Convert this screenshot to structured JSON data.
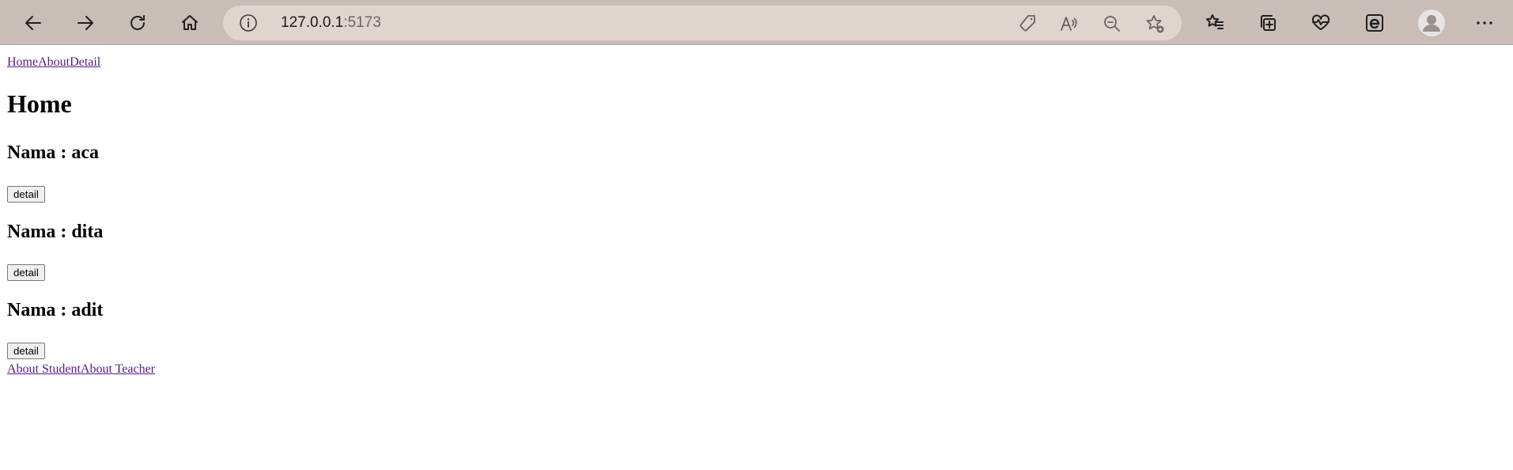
{
  "browser": {
    "url_host": "127.0.0.1",
    "url_port": ":5173",
    "icons": {
      "back": "back-arrow-icon",
      "forward": "forward-arrow-icon",
      "refresh": "refresh-icon",
      "home": "home-icon",
      "site_info": "info-icon",
      "tag": "tag-icon",
      "read_aloud": "read-aloud-icon",
      "zoom_out": "zoom-out-icon",
      "add_favorite": "add-favorite-icon",
      "favorites": "favorites-icon",
      "collections": "collections-icon",
      "browser_essentials": "heartbeat-icon",
      "ie_mode": "ie-mode-icon",
      "profile": "profile-icon",
      "more": "more-icon"
    },
    "colors": {
      "toolbar": "#c9bdb8",
      "address_bar": "#e0d4cf"
    }
  },
  "nav": {
    "links": [
      "Home",
      "About",
      "Detail"
    ]
  },
  "main": {
    "title": "Home",
    "students": [
      {
        "label": "Nama : aca",
        "button": "detail"
      },
      {
        "label": "Nama : dita",
        "button": "detail"
      },
      {
        "label": "Nama : adit",
        "button": "detail"
      }
    ]
  },
  "footer_nav": {
    "links": [
      "About Student",
      "About Teacher"
    ]
  },
  "colors": {
    "visited_link": "#551a8b"
  }
}
